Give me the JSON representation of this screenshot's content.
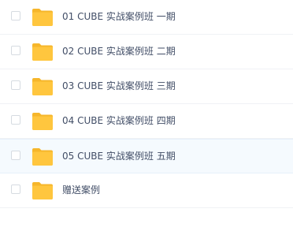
{
  "colors": {
    "folder": "#ffc63e",
    "folder_back": "#f6b62b",
    "text": "#424e67",
    "row_divider": "#f0f2f5",
    "highlight_row": "#f5fafe"
  },
  "files": [
    {
      "name": "01 CUBE 实战案例班 一期",
      "icon": "folder-icon",
      "checked": false,
      "highlighted": false
    },
    {
      "name": "02 CUBE 实战案例班 二期",
      "icon": "folder-icon",
      "checked": false,
      "highlighted": false
    },
    {
      "name": "03 CUBE 实战案例班 三期",
      "icon": "folder-icon",
      "checked": false,
      "highlighted": false
    },
    {
      "name": "04 CUBE 实战案例班 四期",
      "icon": "folder-icon",
      "checked": false,
      "highlighted": false
    },
    {
      "name": "05 CUBE 实战案例班 五期",
      "icon": "folder-icon",
      "checked": false,
      "highlighted": true
    },
    {
      "name": "赠送案例",
      "icon": "folder-icon",
      "checked": false,
      "highlighted": false
    }
  ]
}
